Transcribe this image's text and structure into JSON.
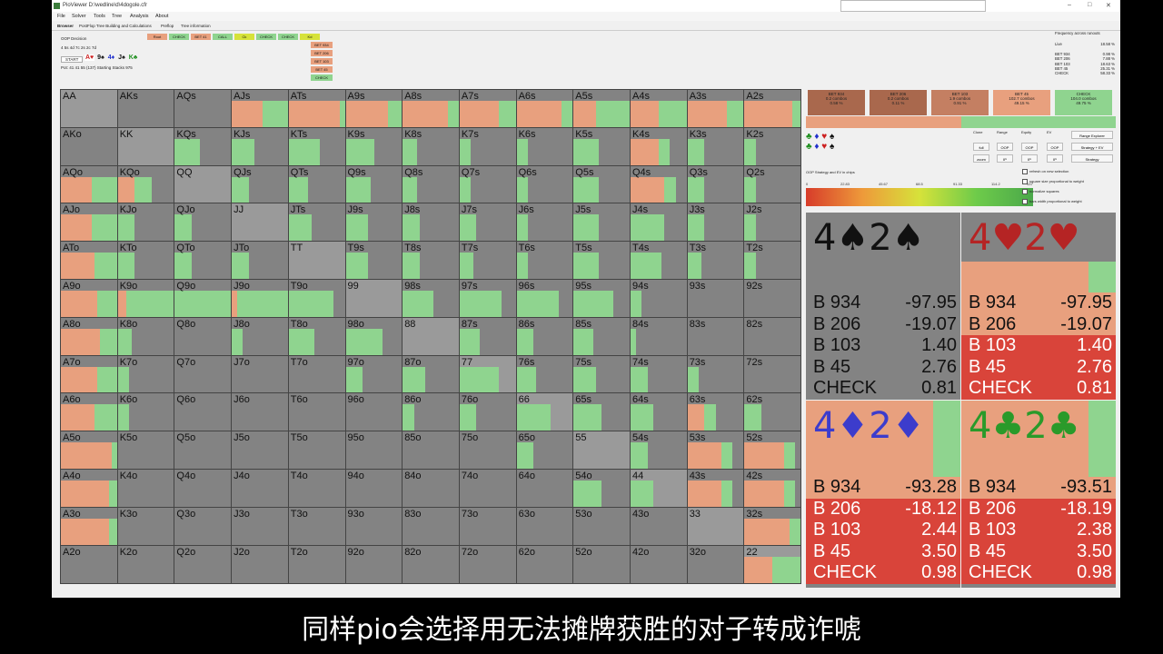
{
  "window": {
    "title": "PioViewer D:\\wedline\\d\\4dogole.cfr",
    "menu": [
      "File",
      "Solver",
      "Tools",
      "Tree",
      "Analysis",
      "About"
    ],
    "tabs": [
      "Browser",
      "PostFlop Tree Building and Calculations",
      "Preflop",
      "Tree information"
    ],
    "controls": {
      "title": "OOP Decision",
      "board_line": "4 5s 4d 7c 2s 2c 7d",
      "start_label": "START",
      "pot_line": "Pot: 41 41 55 (137) Starting Stacks 975"
    },
    "board_cards": [
      {
        "text": "A♥",
        "color": "#cc2020"
      },
      {
        "text": "9♠",
        "color": "#111111"
      },
      {
        "text": "4♦",
        "color": "#2030cc"
      },
      {
        "text": "J♠",
        "color": "#111111"
      },
      {
        "text": "K♣",
        "color": "#209020"
      }
    ]
  },
  "action_buttons": [
    {
      "label": "Root",
      "color": "#e8a07e"
    },
    {
      "label": "CHECK",
      "color": "#8fd48f"
    },
    {
      "label": "BET 41",
      "color": "#e8a07e"
    },
    {
      "label": "CALL",
      "color": "#8fd48f"
    },
    {
      "label": "Ck",
      "color": "#d6e23a"
    },
    {
      "label": "CHECK",
      "color": "#8fd48f"
    },
    {
      "label": "CHECK",
      "color": "#8fd48f"
    },
    {
      "label": "Kd",
      "color": "#d6e23a"
    }
  ],
  "bet_stack": [
    "BET 934",
    "BET 206",
    "BET 103",
    "BET 45",
    "CHECK"
  ],
  "frequency_panel": {
    "title": "Frequency across runouts",
    "live_label": "Live",
    "live_value": "18.58 %",
    "rows": [
      {
        "label": "BET 934",
        "value": "0.98 %"
      },
      {
        "label": "BET 206",
        "value": "7.88 %"
      },
      {
        "label": "BET 103",
        "value": "18.63 %"
      },
      {
        "label": "BET 45",
        "value": "25.31 %"
      },
      {
        "label": "CHECK",
        "value": "58.33 %"
      }
    ]
  },
  "matrix": {
    "ranks": [
      "A",
      "K",
      "Q",
      "J",
      "T",
      "9",
      "8",
      "7",
      "6",
      "5",
      "4",
      "3",
      "2"
    ],
    "selected": "22",
    "cells": {
      "AA": [
        0,
        0
      ],
      "AKs": [
        0,
        0
      ],
      "AQs": [
        0,
        0
      ],
      "AJs": [
        0.55,
        0.45
      ],
      "ATs": [
        0.9,
        0.1
      ],
      "A9s": [
        0.75,
        0.25
      ],
      "A8s": [
        0.8,
        0.2
      ],
      "A7s": [
        0.7,
        0.3
      ],
      "A6s": [
        0.8,
        0.2
      ],
      "A5s": [
        0.4,
        0.6
      ],
      "A4s": [
        0.5,
        0.5
      ],
      "A3s": [
        0.7,
        0.3
      ],
      "A2s": [
        0.85,
        0.15
      ],
      "AKo": [
        0,
        0
      ],
      "KK": [
        0,
        0
      ],
      "KQs": [
        0,
        0.45
      ],
      "KJs": [
        0,
        0.4
      ],
      "KTs": [
        0,
        0.55
      ],
      "K9s": [
        0,
        0.5
      ],
      "K8s": [
        0,
        0.25
      ],
      "K7s": [
        0,
        0.2
      ],
      "K6s": [
        0,
        0.2
      ],
      "K5s": [
        0,
        0.45
      ],
      "K4s": [
        0.5,
        0.2
      ],
      "K3s": [
        0,
        0.3
      ],
      "K2s": [
        0,
        0.2
      ],
      "AQo": [
        0.55,
        0.45
      ],
      "KQo": [
        0.3,
        0.3
      ],
      "QQ": [
        0,
        0
      ],
      "QJs": [
        0,
        0.3
      ],
      "QTs": [
        0,
        0.35
      ],
      "Q9s": [
        0,
        0.45
      ],
      "Q8s": [
        0,
        0.25
      ],
      "Q7s": [
        0,
        0.2
      ],
      "Q6s": [
        0,
        0.2
      ],
      "Q5s": [
        0,
        0.45
      ],
      "Q4s": [
        0.6,
        0.2
      ],
      "Q3s": [
        0,
        0.3
      ],
      "Q2s": [
        0,
        0.2
      ],
      "AJo": [
        0.55,
        0.45
      ],
      "KJo": [
        0,
        0.3
      ],
      "QJo": [
        0,
        0.3
      ],
      "JJ": [
        0,
        0
      ],
      "JTs": [
        0,
        0.4
      ],
      "J9s": [
        0,
        0.4
      ],
      "J8s": [
        0,
        0.3
      ],
      "J7s": [
        0,
        0.3
      ],
      "J6s": [
        0,
        0.2
      ],
      "J5s": [
        0,
        0.45
      ],
      "J4s": [
        0,
        0.6
      ],
      "J3s": [
        0,
        0.3
      ],
      "J2s": [
        0,
        0.2
      ],
      "ATo": [
        0.6,
        0.4
      ],
      "KTo": [
        0,
        0.3
      ],
      "QTo": [
        0,
        0.3
      ],
      "JTo": [
        0,
        0.3
      ],
      "TT": [
        0,
        0
      ],
      "T9s": [
        0,
        0.4
      ],
      "T8s": [
        0,
        0.3
      ],
      "T7s": [
        0,
        0.25
      ],
      "T6s": [
        0,
        0.2
      ],
      "T5s": [
        0,
        0.45
      ],
      "T4s": [
        0,
        0.55
      ],
      "T3s": [
        0,
        0.25
      ],
      "T2s": [
        0,
        0.2
      ],
      "A9o": [
        0.65,
        0.35
      ],
      "K9o": [
        0.15,
        0.85
      ],
      "Q9o": [
        0,
        1
      ],
      "J9o": [
        0.1,
        0.9
      ],
      "T9o": [
        0,
        0.8
      ],
      "99": [
        0,
        0
      ],
      "98s": [
        0,
        0.55
      ],
      "97s": [
        0,
        0.75
      ],
      "96s": [
        0,
        0.75
      ],
      "95s": [
        0,
        0.7
      ],
      "94s": [
        0,
        0.2
      ],
      "93s": [
        0,
        0
      ],
      "92s": [
        0,
        0
      ],
      "A8o": [
        0.7,
        0.3
      ],
      "K8o": [
        0,
        0.25
      ],
      "Q8o": [
        0,
        0
      ],
      "J8o": [
        0,
        0.2
      ],
      "T8o": [
        0,
        0.45
      ],
      "98o": [
        0,
        0.65
      ],
      "88": [
        0,
        0
      ],
      "87s": [
        0,
        0.35
      ],
      "86s": [
        0,
        0.3
      ],
      "85s": [
        0,
        0.35
      ],
      "84s": [
        0,
        0.1
      ],
      "83s": [
        0,
        0
      ],
      "82s": [
        0,
        0
      ],
      "A7o": [
        0.65,
        0.35
      ],
      "K7o": [
        0,
        0.2
      ],
      "Q7o": [
        0,
        0
      ],
      "J7o": [
        0,
        0
      ],
      "T7o": [
        0,
        0
      ],
      "97o": [
        0,
        0.3
      ],
      "87o": [
        0,
        0.4
      ],
      "77": [
        0,
        0.7
      ],
      "76s": [
        0,
        0.35
      ],
      "75s": [
        0,
        0.4
      ],
      "74s": [
        0,
        0.3
      ],
      "73s": [
        0,
        0.2
      ],
      "72s": [
        0,
        0
      ],
      "A6o": [
        0.6,
        0.4
      ],
      "K6o": [
        0,
        0.2
      ],
      "Q6o": [
        0,
        0
      ],
      "J6o": [
        0,
        0
      ],
      "T6o": [
        0,
        0
      ],
      "96o": [
        0,
        0
      ],
      "86o": [
        0,
        0.2
      ],
      "76o": [
        0,
        0.3
      ],
      "66": [
        0,
        0.6
      ],
      "65s": [
        0,
        0.5
      ],
      "64s": [
        0,
        0.4
      ],
      "63s": [
        0.3,
        0.2
      ],
      "62s": [
        0,
        0.3
      ],
      "A5o": [
        0.9,
        0.1
      ],
      "K5o": [
        0,
        0
      ],
      "Q5o": [
        0,
        0
      ],
      "J5o": [
        0,
        0
      ],
      "T5o": [
        0,
        0
      ],
      "95o": [
        0,
        0
      ],
      "85o": [
        0,
        0
      ],
      "75o": [
        0,
        0
      ],
      "65o": [
        0,
        0.3
      ],
      "55": [
        0,
        0
      ],
      "54s": [
        0,
        0.3
      ],
      "53s": [
        0.6,
        0.2
      ],
      "52s": [
        0.7,
        0.2
      ],
      "A4o": [
        0.85,
        0.15
      ],
      "K4o": [
        0,
        0
      ],
      "Q4o": [
        0,
        0
      ],
      "J4o": [
        0,
        0
      ],
      "T4o": [
        0,
        0
      ],
      "94o": [
        0,
        0
      ],
      "84o": [
        0,
        0
      ],
      "74o": [
        0,
        0
      ],
      "64o": [
        0,
        0
      ],
      "54o": [
        0,
        0.5
      ],
      "44": [
        0,
        0.4
      ],
      "43s": [
        0.6,
        0.2
      ],
      "42s": [
        0.7,
        0.2
      ],
      "A3o": [
        0.85,
        0.15
      ],
      "K3o": [
        0,
        0
      ],
      "Q3o": [
        0,
        0
      ],
      "J3o": [
        0,
        0
      ],
      "T3o": [
        0,
        0
      ],
      "93o": [
        0,
        0
      ],
      "83o": [
        0,
        0
      ],
      "73o": [
        0,
        0
      ],
      "63o": [
        0,
        0
      ],
      "53o": [
        0,
        0
      ],
      "43o": [
        0,
        0
      ],
      "33": [
        0,
        0
      ],
      "32s": [
        0.8,
        0.2
      ],
      "A2o": [
        0,
        0
      ],
      "K2o": [
        0,
        0
      ],
      "Q2o": [
        0,
        0
      ],
      "J2o": [
        0,
        0
      ],
      "T2o": [
        0,
        0
      ],
      "92o": [
        0,
        0
      ],
      "82o": [
        0,
        0
      ],
      "72o": [
        0,
        0
      ],
      "62o": [
        0,
        0
      ],
      "52o": [
        0,
        0
      ],
      "42o": [
        0,
        0
      ],
      "32o": [
        0,
        0
      ],
      "22": [
        0.5,
        0.5
      ]
    }
  },
  "strategy_summary": [
    {
      "label": "BET 934",
      "combos": "0.2 combos",
      "pct": "0.58 %",
      "color": "#a9684d"
    },
    {
      "label": "BET 206",
      "combos": "0.2 combos",
      "pct": "0.11 %",
      "color": "#a9684d"
    },
    {
      "label": "BET 103",
      "combos": "1.9 combos",
      "pct": "0.91 %",
      "color": "#c47f62"
    },
    {
      "label": "BET 45",
      "combos": "102.7 combos",
      "pct": "49.15 %",
      "color": "#e8a07e"
    },
    {
      "label": "CHECK",
      "combos": "104.0 combos",
      "pct": "49.75 %",
      "color": "#8fd48f"
    }
  ],
  "side_controls": {
    "header_cols": [
      "Clone",
      "Range",
      "Equity",
      "EV"
    ],
    "range_explorer": "Range Explorer",
    "strategy_ev": "Strategy + EV",
    "strategy": "Strategy",
    "full": "full",
    "zoom": "zoom",
    "oop": "OOP",
    "ip": "IP",
    "legend_title": "OOP Strategy and EV in chips",
    "scale": [
      "0",
      "22.83",
      "45.67",
      "68.5",
      "91.33",
      "114.2",
      "137"
    ],
    "checkboxes": [
      "refresh on new selection",
      "square size proportional to weight",
      "normalize squares",
      "bars width proportional to weight"
    ]
  },
  "combo_cards": [
    {
      "title": "4♠2♠",
      "color": "#111111",
      "lines": [
        {
          "label": "B 934",
          "value": "-97.95"
        },
        {
          "label": "B 206",
          "value": "-19.07"
        },
        {
          "label": "B 103",
          "value": "1.40"
        },
        {
          "label": "B 45",
          "value": "2.76"
        },
        {
          "label": "CHECK",
          "value": "0.81"
        }
      ]
    },
    {
      "title": "4♥2♥",
      "color": "#b52424",
      "lines": [
        {
          "label": "B 934",
          "value": "-97.95"
        },
        {
          "label": "B 206",
          "value": "-19.07"
        },
        {
          "label": "B 103",
          "value": "1.40"
        },
        {
          "label": "B 45",
          "value": "2.76"
        },
        {
          "label": "CHECK",
          "value": "0.81"
        }
      ]
    },
    {
      "title": "4♦2♦",
      "color": "#3c3ccc",
      "lines": [
        {
          "label": "B 934",
          "value": "-93.28"
        },
        {
          "label": "B 206",
          "value": "-18.12"
        },
        {
          "label": "B 103",
          "value": "2.44"
        },
        {
          "label": "B 45",
          "value": "3.50"
        },
        {
          "label": "CHECK",
          "value": "0.98"
        }
      ]
    },
    {
      "title": "4♣2♣",
      "color": "#2a9a2a",
      "lines": [
        {
          "label": "B 934",
          "value": "-93.51"
        },
        {
          "label": "B 206",
          "value": "-18.19"
        },
        {
          "label": "B 103",
          "value": "2.38"
        },
        {
          "label": "B 45",
          "value": "3.50"
        },
        {
          "label": "CHECK",
          "value": "0.98"
        }
      ]
    }
  ],
  "subtitle": "同样pio会选择用无法摊牌获胜的对子转成诈唬"
}
